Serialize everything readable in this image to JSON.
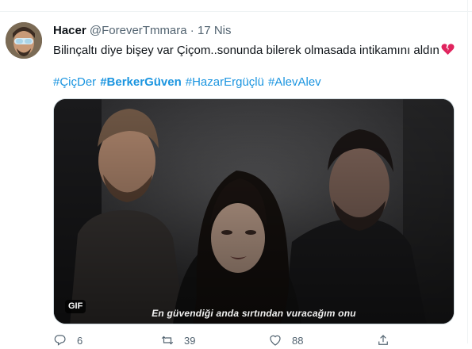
{
  "tweet": {
    "author_name": "Hacer",
    "author_handle": "@ForeverTmmara",
    "separator": "·",
    "date": "17 Nis",
    "text": "Bilinçaltı diye bişey var Çiçom..sonunda bilerek olmasada intikamını aldın",
    "emoji": "broken-heart",
    "hashtags": [
      {
        "text": "#ÇiçDer",
        "bold": false
      },
      {
        "text": "#BerkerGüven",
        "bold": true
      },
      {
        "text": "#HazarErgüçlü",
        "bold": false
      },
      {
        "text": "#AlevAlev",
        "bold": false
      }
    ]
  },
  "media": {
    "badge": "GIF",
    "subtitle": "En güvendiği anda sırtından vuracağım onu"
  },
  "actions": {
    "reply_count": "6",
    "retweet_count": "39",
    "like_count": "88"
  },
  "colors": {
    "hashtag": "#1b95e0",
    "secondary_text": "#536471",
    "broken_heart": "#e0245e"
  }
}
